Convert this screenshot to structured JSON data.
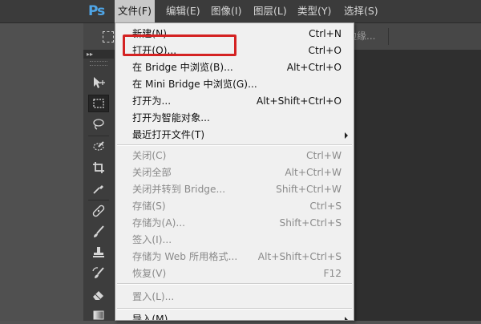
{
  "app": {
    "logo_text": "Ps"
  },
  "menubar": {
    "items": [
      {
        "label": "文件(F)",
        "active": true
      },
      {
        "label": "编辑(E)"
      },
      {
        "label": "图像(I)"
      },
      {
        "label": "图层(L)"
      },
      {
        "label": "类型(Y)"
      },
      {
        "label": "选择(S)"
      }
    ]
  },
  "options_bar": {
    "refine_edge_label": "调整边缘..."
  },
  "toolbox": {
    "collapse_glyph": "▸▸",
    "tools": [
      {
        "icon": "move-tool-icon"
      },
      {
        "icon": "rectangular-marquee-icon",
        "selected": true
      },
      {
        "icon": "lasso-icon"
      },
      {
        "icon": "quick-selection-icon"
      },
      {
        "icon": "crop-icon"
      },
      {
        "icon": "eyedropper-icon"
      },
      {
        "icon": "spot-healing-icon"
      },
      {
        "icon": "brush-icon"
      },
      {
        "icon": "clone-stamp-icon"
      },
      {
        "icon": "history-brush-icon"
      },
      {
        "icon": "eraser-icon"
      },
      {
        "icon": "gradient-icon"
      }
    ]
  },
  "file_menu": {
    "items": [
      {
        "label": "新建(N)...",
        "shortcut": "Ctrl+N"
      },
      {
        "label": "打开(O)...",
        "shortcut": "Ctrl+O",
        "highlighted": true
      },
      {
        "label": "在 Bridge 中浏览(B)...",
        "shortcut": "Alt+Ctrl+O"
      },
      {
        "label": "在 Mini Bridge 中浏览(G)...",
        "shortcut": ""
      },
      {
        "label": "打开为...",
        "shortcut": "Alt+Shift+Ctrl+O"
      },
      {
        "label": "打开为智能对象...",
        "shortcut": ""
      },
      {
        "label": "最近打开文件(T)",
        "shortcut": "",
        "submenu": true
      },
      {
        "label": "关闭(C)",
        "shortcut": "Ctrl+W",
        "disabled": true
      },
      {
        "label": "关闭全部",
        "shortcut": "Alt+Ctrl+W",
        "disabled": true
      },
      {
        "label": "关闭并转到 Bridge...",
        "shortcut": "Shift+Ctrl+W",
        "disabled": true
      },
      {
        "label": "存储(S)",
        "shortcut": "Ctrl+S",
        "disabled": true
      },
      {
        "label": "存储为(A)...",
        "shortcut": "Shift+Ctrl+S",
        "disabled": true
      },
      {
        "label": "签入(I)...",
        "shortcut": "",
        "disabled": true
      },
      {
        "label": "存储为 Web 所用格式...",
        "shortcut": "Alt+Shift+Ctrl+S",
        "disabled": true
      },
      {
        "label": "恢复(V)",
        "shortcut": "F12",
        "disabled": true
      },
      {
        "label": "置入(L)...",
        "shortcut": "",
        "disabled": true
      },
      {
        "label": "导入(M)",
        "shortcut": "",
        "submenu": true
      }
    ]
  },
  "colors": {
    "highlight_border": "#d42222",
    "ps_logo": "#4fa6e8"
  }
}
